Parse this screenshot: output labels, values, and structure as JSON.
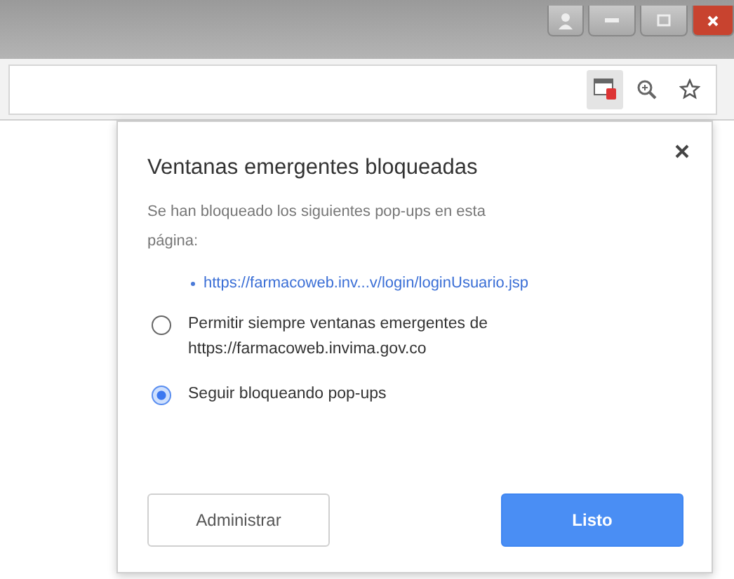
{
  "browser": {
    "has_popup_blocked_indicator": true
  },
  "popup": {
    "title": "Ventanas emergentes bloqueadas",
    "description_lines": [
      "Se han bloqueado los siguientes pop-ups en esta",
      "página:"
    ],
    "blocked_links": [
      "https://farmacoweb.inv...v/login/loginUsuario.jsp"
    ],
    "options": [
      {
        "label_lines": [
          "Permitir siempre ventanas emergentes de",
          "https://farmacoweb.invima.gov.co"
        ],
        "selected": false
      },
      {
        "label_lines": [
          "Seguir bloqueando pop-ups"
        ],
        "selected": true
      }
    ],
    "buttons": [
      {
        "label": "Administrar",
        "kind": "secondary"
      },
      {
        "label": "Listo",
        "kind": "primary"
      }
    ]
  }
}
